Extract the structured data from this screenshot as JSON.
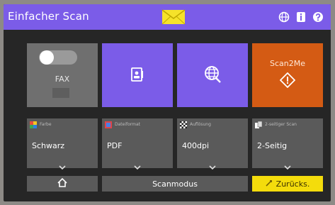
{
  "header": {
    "title": "Einfacher Scan",
    "icons": [
      "mail-icon",
      "globe-icon",
      "info-icon",
      "help-icon"
    ]
  },
  "tiles": {
    "fax": {
      "label": "FAX",
      "icon": "toggle-icon"
    },
    "id_card": {
      "icon": "id-card-icon"
    },
    "web": {
      "icon": "globe-search-icon"
    },
    "scan2me": {
      "label": "Scan2Me",
      "icon": "start-diamond-icon"
    }
  },
  "settings": [
    {
      "caption": "Farbe",
      "value": "Schwarz",
      "icon": "color-palette-icon"
    },
    {
      "caption": "Dateiformat",
      "value": "PDF",
      "icon": "file-format-icon"
    },
    {
      "caption": "Auflösung",
      "value": "400dpi",
      "icon": "resolution-icon"
    },
    {
      "caption": "2-seitiger Scan",
      "value": "2-Seitig",
      "icon": "duplex-icon"
    }
  ],
  "bottom": {
    "home_icon": "home-icon",
    "mode_label": "Scanmodus",
    "back_label": "Zurücks."
  },
  "colors": {
    "accent_purple": "#7b5ce8",
    "scan_orange": "#d45b14",
    "back_yellow": "#f4dc0c",
    "tile_gray": "#5a5a5a"
  }
}
